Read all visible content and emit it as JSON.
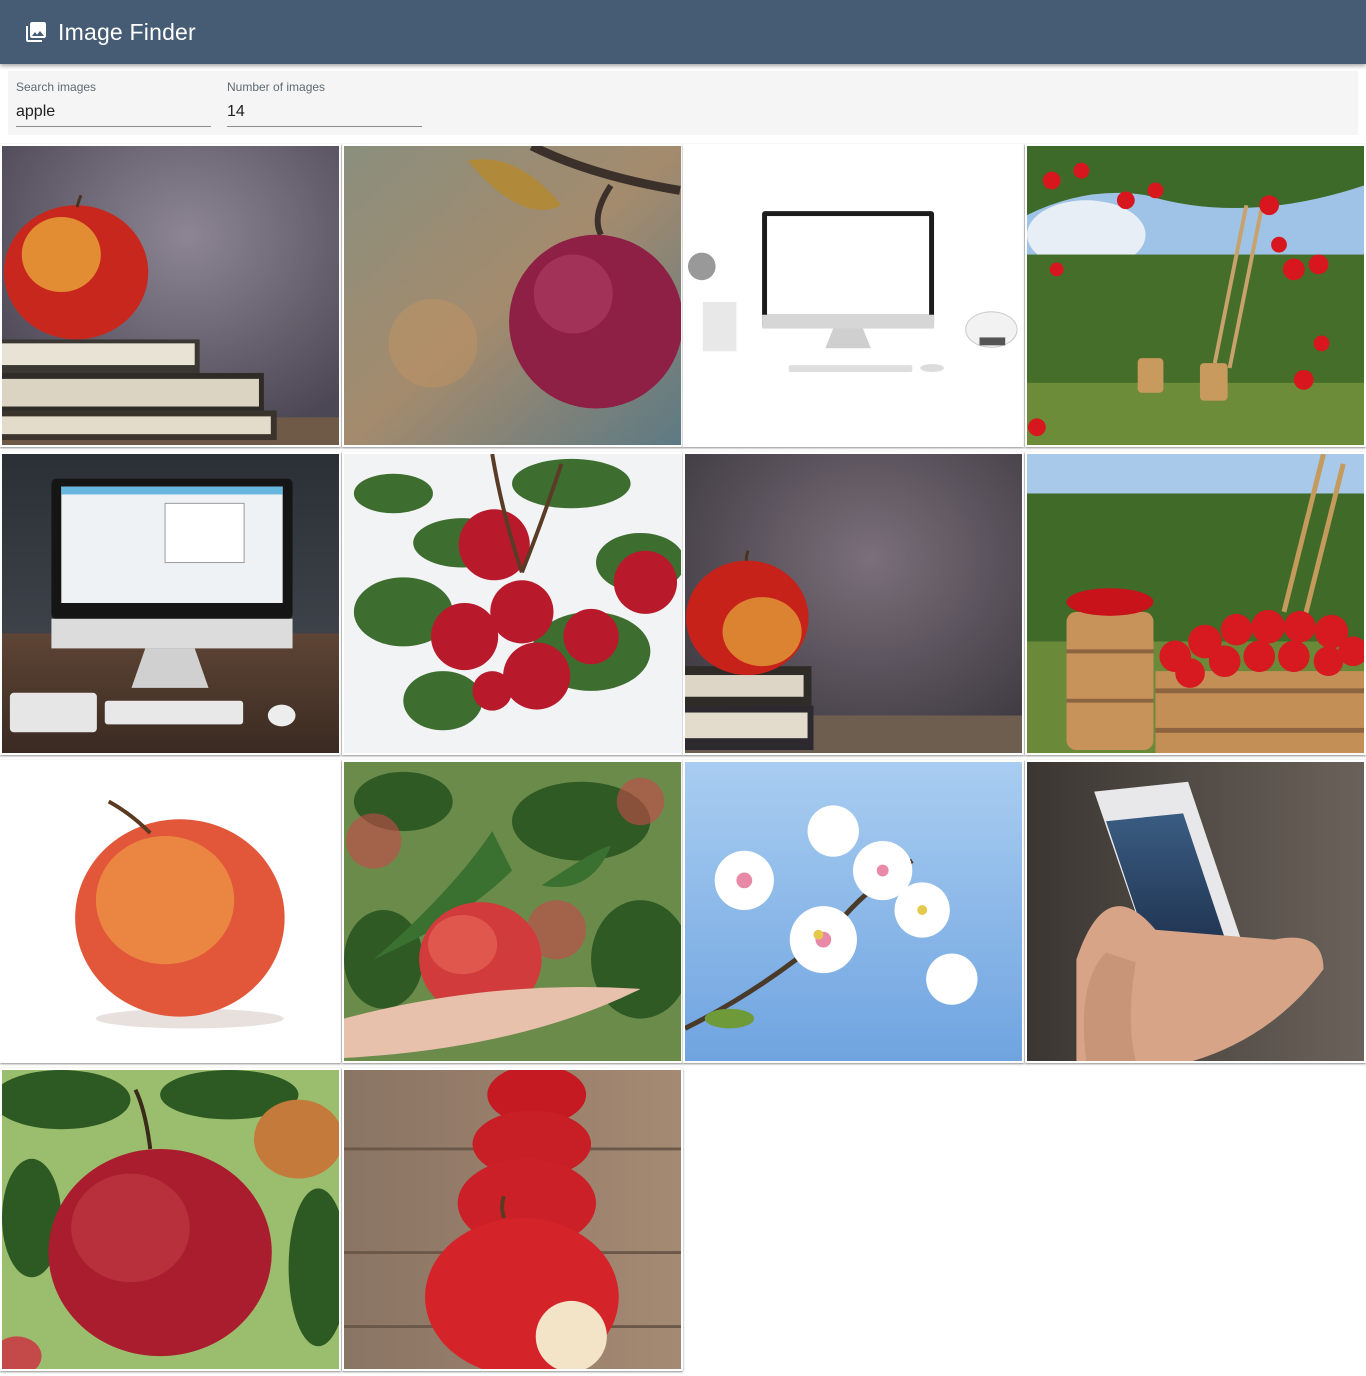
{
  "app": {
    "title": "Image Finder",
    "icon": "photo-library-icon"
  },
  "search": {
    "query_label": "Search images",
    "query_value": "apple",
    "count_label": "Number of images",
    "count_value": "14"
  },
  "results": [
    {
      "name": "apple-on-books"
    },
    {
      "name": "red-apple-on-branch"
    },
    {
      "name": "imac-desk-white"
    },
    {
      "name": "apple-orchard-ladder"
    },
    {
      "name": "imac-desk-dark"
    },
    {
      "name": "apple-cluster-on-tree"
    },
    {
      "name": "apple-on-books-2"
    },
    {
      "name": "apple-baskets-orchard"
    },
    {
      "name": "apple-white-background"
    },
    {
      "name": "apple-in-hand"
    },
    {
      "name": "apple-blossoms"
    },
    {
      "name": "iphone-in-hand"
    },
    {
      "name": "apple-among-leaves"
    },
    {
      "name": "bitten-apple-row"
    }
  ]
}
